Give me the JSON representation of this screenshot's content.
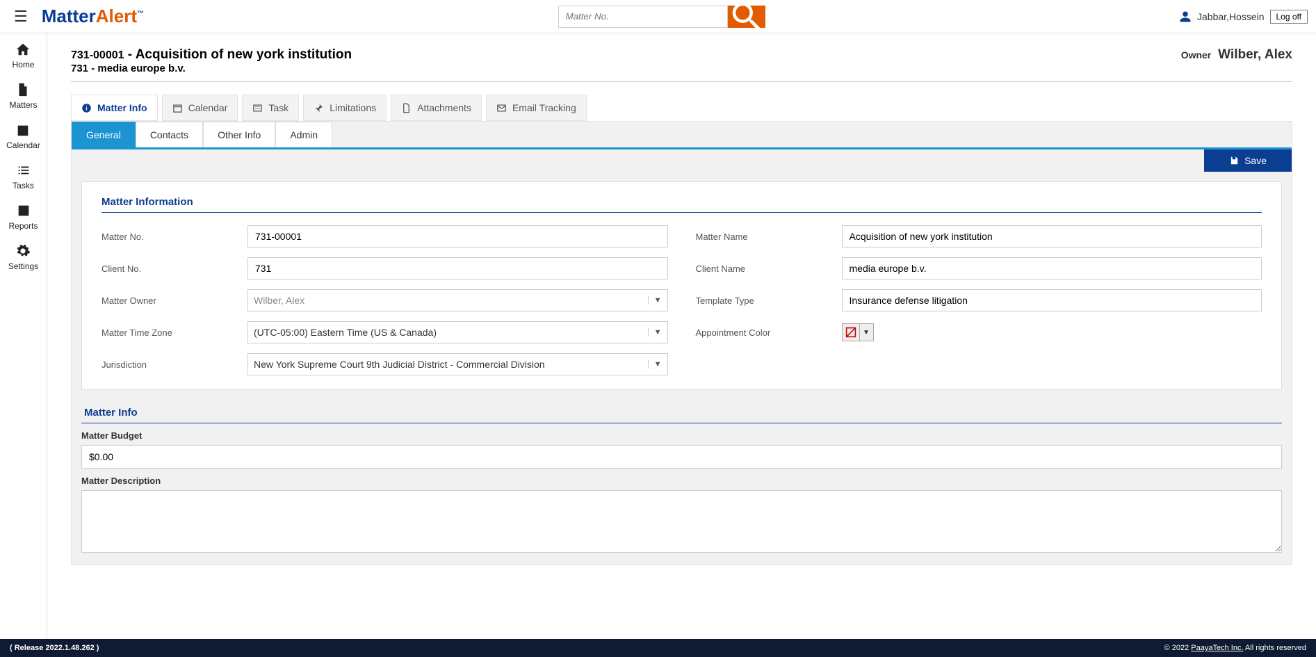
{
  "brand": {
    "part1": "Matter",
    "part2": "Alert",
    "tm": "™"
  },
  "search": {
    "placeholder": "Matter No."
  },
  "user": {
    "name": "Jabbar,Hossein",
    "logoff": "Log off"
  },
  "sidebar": [
    {
      "label": "Home",
      "icon": "home-icon"
    },
    {
      "label": "Matters",
      "icon": "document-icon"
    },
    {
      "label": "Calendar",
      "icon": "calendar-icon"
    },
    {
      "label": "Tasks",
      "icon": "list-icon"
    },
    {
      "label": "Reports",
      "icon": "report-icon"
    },
    {
      "label": "Settings",
      "icon": "gear-icon"
    }
  ],
  "page": {
    "matter_no": "731-00001",
    "title_sep": " - ",
    "title": "Acquisition of new york institution",
    "client_line": "731 - media europe b.v.",
    "owner_label": "Owner",
    "owner_name": "Wilber, Alex"
  },
  "ptabs": [
    {
      "label": "Matter Info",
      "icon": "info-icon"
    },
    {
      "label": "Calendar",
      "icon": "calendar-icon"
    },
    {
      "label": "Task",
      "icon": "list-icon"
    },
    {
      "label": "Limitations",
      "icon": "pin-icon"
    },
    {
      "label": "Attachments",
      "icon": "attach-icon"
    },
    {
      "label": "Email Tracking",
      "icon": "mail-icon"
    }
  ],
  "subtabs": [
    "General",
    "Contacts",
    "Other Info",
    "Admin"
  ],
  "save_label": "Save",
  "section1_title": "Matter Information",
  "form": {
    "matter_no_label": "Matter No.",
    "matter_no": "731-00001",
    "client_no_label": "Client No.",
    "client_no": "731",
    "matter_owner_label": "Matter Owner",
    "matter_owner": "Wilber, Alex",
    "tz_label": "Matter Time Zone",
    "tz": "(UTC-05:00) Eastern Time (US & Canada)",
    "juris_label": "Jurisdiction",
    "juris": "New York Supreme Court 9th Judicial District - Commercial Division",
    "matter_name_label": "Matter Name",
    "matter_name": "Acquisition of new york institution",
    "client_name_label": "Client Name",
    "client_name": "media europe b.v.",
    "template_label": "Template Type",
    "template": "Insurance defense litigation",
    "color_label": "Appointment Color"
  },
  "section2_title": "Matter Info",
  "budget_label": "Matter Budget",
  "budget_value": "$0.00",
  "desc_label": "Matter Description",
  "footer": {
    "release": "( Release 2022.1.48.262 )",
    "copyright_prefix": "© 2022 ",
    "company": "PaayaTech Inc.",
    "copyright_suffix": " All rights reserved"
  }
}
